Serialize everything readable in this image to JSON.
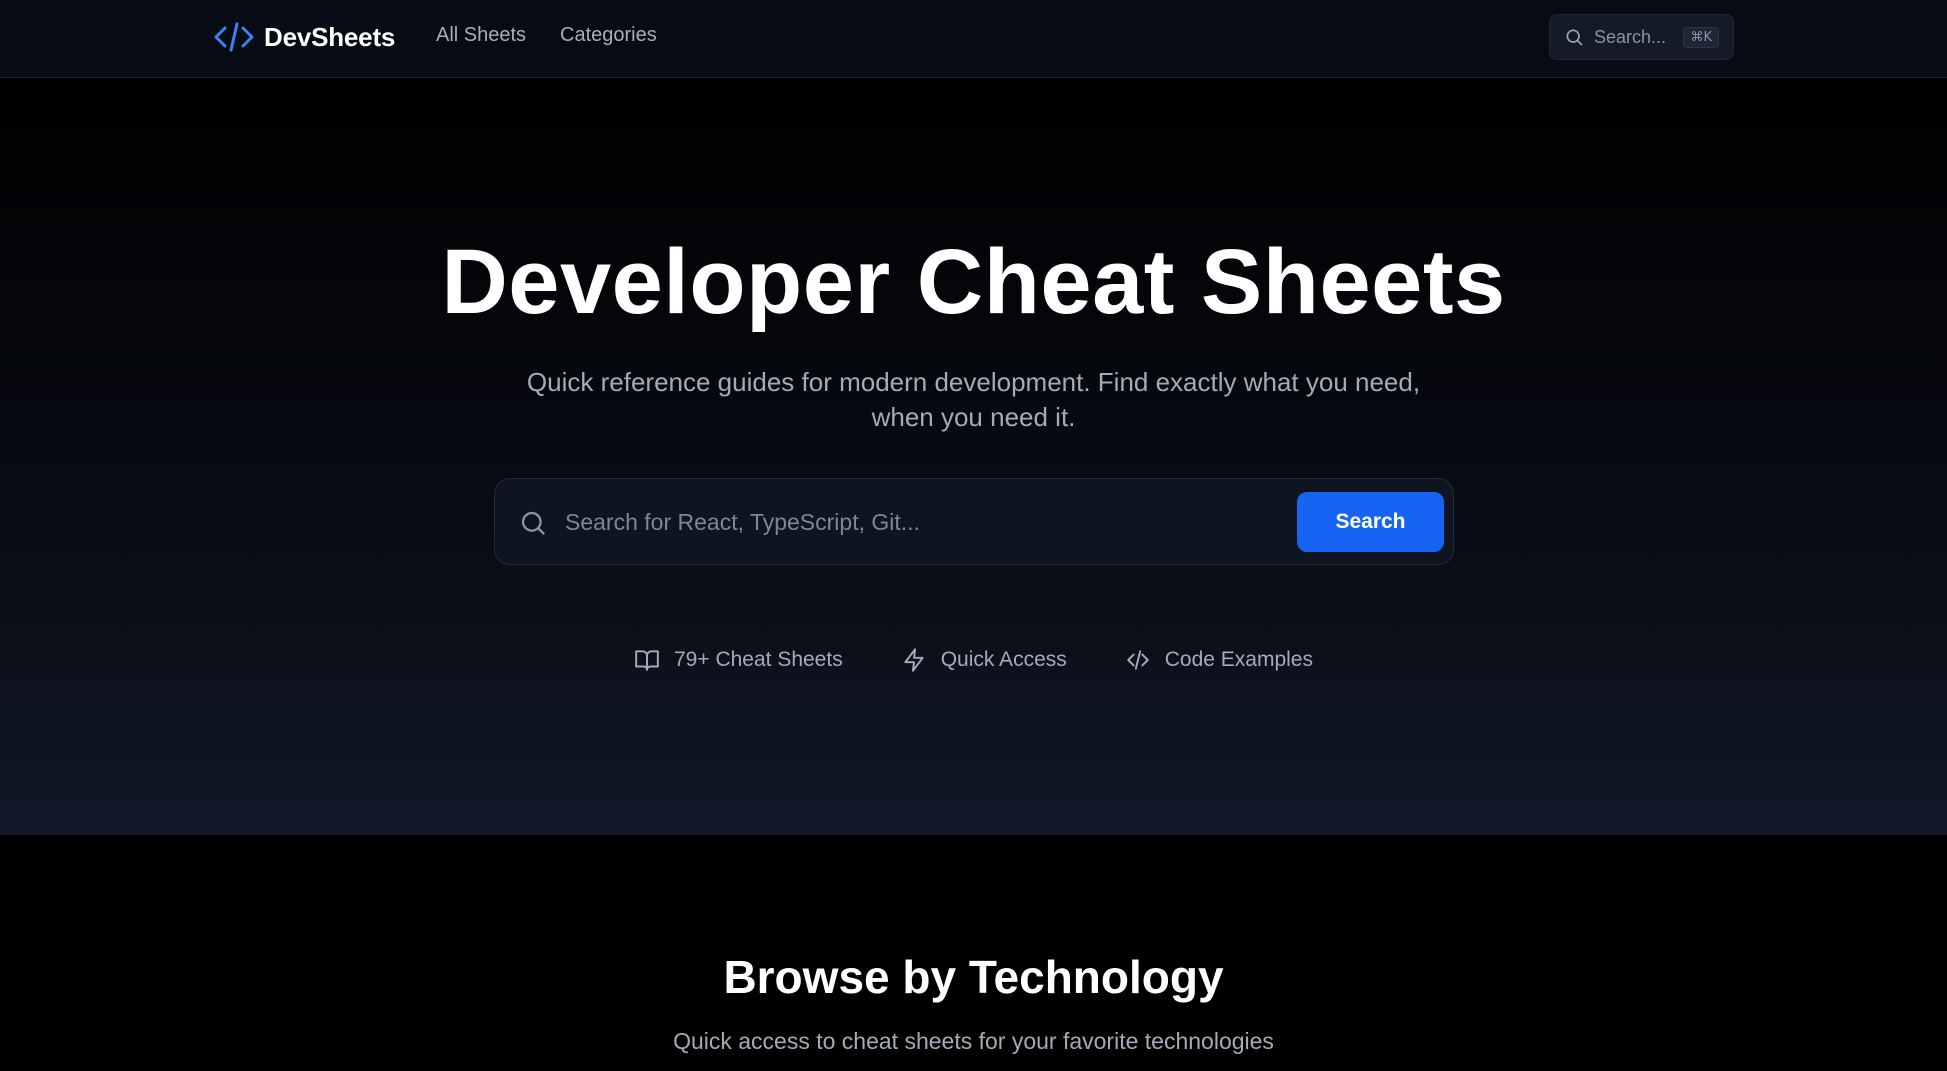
{
  "nav": {
    "brand": "DevSheets",
    "links": [
      "All Sheets",
      "Categories"
    ],
    "search_placeholder": "Search...",
    "shortcut": "⌘K"
  },
  "hero": {
    "title": "Developer Cheat Sheets",
    "subtitle": "Quick reference guides for modern development. Find exactly what you need, when you need it.",
    "search_placeholder": "Search for React, TypeScript, Git...",
    "search_button": "Search",
    "features": [
      {
        "icon": "book-icon",
        "label": "79+ Cheat Sheets"
      },
      {
        "icon": "lightning-icon",
        "label": "Quick Access"
      },
      {
        "icon": "code-icon",
        "label": "Code Examples"
      }
    ]
  },
  "browse": {
    "title": "Browse by Technology",
    "subtitle": "Quick access to cheat sheets for your favorite technologies"
  },
  "colors": {
    "accent": "#1764f4",
    "logo_blue": "#3b82f6",
    "background": "#000000"
  }
}
